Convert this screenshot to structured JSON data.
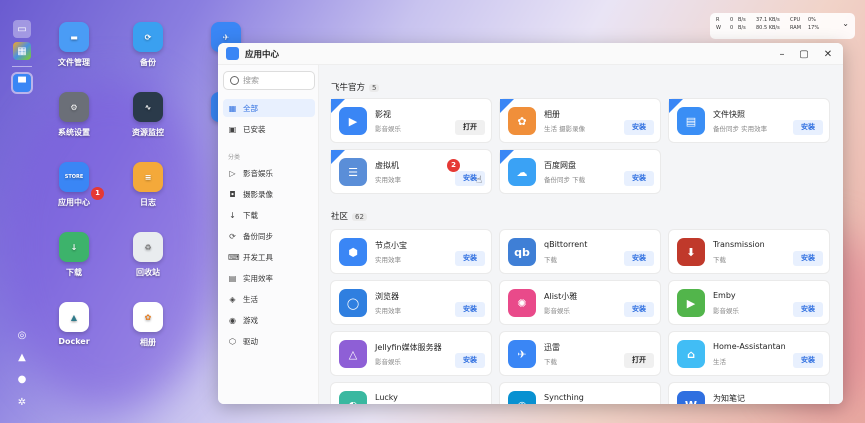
{
  "desktop": {
    "icons": [
      {
        "label": "文件管理",
        "color": "#4a9cf5",
        "glyph": "▬"
      },
      {
        "label": "备份",
        "color": "#3aa0f0",
        "glyph": "⟳"
      },
      {
        "label": "系统设置",
        "color": "#6b6f78",
        "glyph": "⚙"
      },
      {
        "label": "资源监控",
        "color": "#2a3a4a",
        "glyph": "∿"
      },
      {
        "label": "应用中心",
        "color": "#3a86f5",
        "glyph": "STORE"
      },
      {
        "label": "日志",
        "color": "#f4a93a",
        "glyph": "≡"
      },
      {
        "label": "下载",
        "color": "#3db36b",
        "glyph": "↓"
      },
      {
        "label": "回收站",
        "color": "#e9ecef",
        "glyph": "♻"
      },
      {
        "label": "Docker",
        "color": "#ffffff",
        "glyph": "▲"
      },
      {
        "label": "相册",
        "color": "#ffffff",
        "glyph": "✿"
      }
    ],
    "badge1": "1"
  },
  "monitor": {
    "r_label": "R",
    "w_label": "W",
    "r_val": "0",
    "w_val": "0",
    "unit1": "B/s",
    "unit2": "B/s",
    "net_up": "37.1 KB/s",
    "net_down": "80.5 KB/s",
    "cpu_label": "CPU",
    "ram_label": "RAM",
    "cpu": "0%",
    "ram": "17%"
  },
  "window": {
    "title": "应用中心"
  },
  "sidebar": {
    "search_placeholder": "搜索",
    "all": "全部",
    "installed": "已安装",
    "category_header": "分类",
    "categories": [
      "影音娱乐",
      "摄影录像",
      "下载",
      "备份同步",
      "开发工具",
      "实用效率",
      "生活",
      "游戏",
      "驱动"
    ]
  },
  "official": {
    "title": "飞牛官方",
    "count": "5",
    "badge2": "2",
    "corner": "OFFICIAL",
    "apps": [
      {
        "name": "影视",
        "desc": "影音娱乐",
        "btn": "打开",
        "type": "open",
        "color": "#3a86f5"
      },
      {
        "name": "相册",
        "desc": "生活 摄影录像",
        "btn": "安装",
        "type": "install",
        "color": "#f08f3a"
      },
      {
        "name": "文件快照",
        "desc": "备份同步 实用效率",
        "btn": "安装",
        "type": "install",
        "color": "#3a8ef5"
      },
      {
        "name": "虚拟机",
        "desc": "实用效率",
        "btn": "安装",
        "type": "install",
        "color": "#5a8ed8"
      },
      {
        "name": "百度网盘",
        "desc": "备份同步 下载",
        "btn": "安装",
        "type": "install",
        "color": "#3aa2f5"
      }
    ]
  },
  "community": {
    "title": "社区",
    "count": "62",
    "apps": [
      {
        "name": "节点小宝",
        "desc": "实用效率",
        "btn": "安装",
        "color": "#3a86f5"
      },
      {
        "name": "qBittorrent",
        "desc": "下载",
        "btn": "安装",
        "color": "#3f7fd6"
      },
      {
        "name": "Transmission",
        "desc": "下载",
        "btn": "安装",
        "color": "#c0392b"
      },
      {
        "name": "浏览器",
        "desc": "实用效率",
        "btn": "安装",
        "color": "#2f7fe0"
      },
      {
        "name": "Alist小雅",
        "desc": "影音娱乐",
        "btn": "安装",
        "color": "#e94a8a"
      },
      {
        "name": "Emby",
        "desc": "影音娱乐",
        "btn": "安装",
        "color": "#52b54b"
      },
      {
        "name": "Jellyfin媒体服务器",
        "desc": "影音娱乐",
        "btn": "安装",
        "color": "#8e5fd6"
      },
      {
        "name": "迅雷",
        "desc": "下载",
        "btn": "打开",
        "color": "#3a86f5"
      },
      {
        "name": "Home-Assistantan",
        "desc": "生活",
        "btn": "安装",
        "color": "#41bdf5"
      },
      {
        "name": "Lucky",
        "desc": "",
        "btn": "",
        "color": "#3ab8a0"
      },
      {
        "name": "Syncthing",
        "desc": "",
        "btn": "",
        "color": "#0891d1"
      },
      {
        "name": "为知笔记",
        "desc": "",
        "btn": "",
        "color": "#2f6fe0"
      }
    ]
  }
}
